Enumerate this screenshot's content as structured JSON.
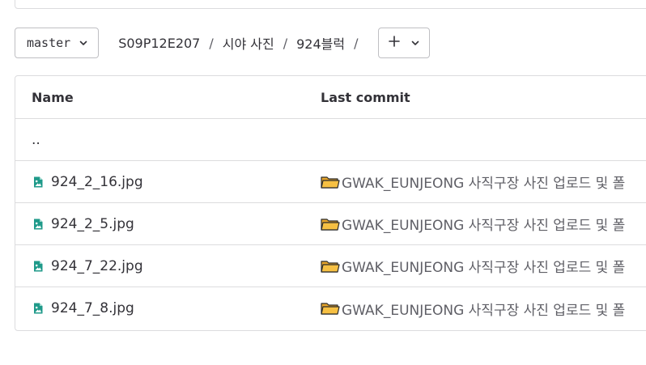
{
  "branch": {
    "label": "master",
    "icon": "chevron-down-icon"
  },
  "breadcrumb": {
    "items": [
      "S09P12E207",
      "시야 사진",
      "924블럭"
    ],
    "separator": "/"
  },
  "add_button": {
    "icons": [
      "plus-icon",
      "chevron-down-icon"
    ]
  },
  "table": {
    "headers": {
      "name": "Name",
      "last_commit": "Last commit"
    },
    "parent_dir": "..",
    "rows": [
      {
        "name": "924_2_16.jpg",
        "commit": "GWAK_EUNJEONG 사직구장 사진 업로드 및 폴"
      },
      {
        "name": "924_2_5.jpg",
        "commit": "GWAK_EUNJEONG 사직구장 사진 업로드 및 폴"
      },
      {
        "name": "924_7_22.jpg",
        "commit": "GWAK_EUNJEONG 사직구장 사진 업로드 및 폴"
      },
      {
        "name": "924_7_8.jpg",
        "commit": "GWAK_EUNJEONG 사직구장 사진 업로드 및 폴"
      }
    ]
  },
  "colors": {
    "border": "#dcdcde",
    "text": "#333238",
    "muted": "#5f5f66",
    "image_icon": "#1f9a8a",
    "folder": "#f6c043"
  }
}
